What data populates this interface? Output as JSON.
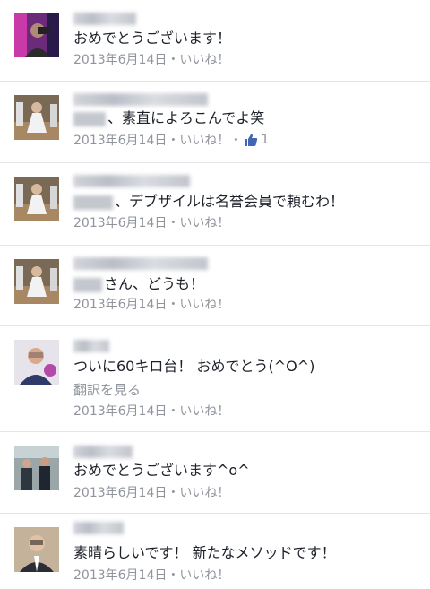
{
  "comments": [
    {
      "text": "おめでとうございます！",
      "date": "2013年6月14日",
      "dot": "・",
      "like_label": "いいね！"
    },
    {
      "text_prefix": "、素直によろこんでよ笑",
      "date": "2013年6月14日",
      "dot": "・",
      "like_label": "いいね！",
      "dot2": "・",
      "like_count": "1"
    },
    {
      "text_prefix": "、デブザイルは名誉会員で頼むわ！",
      "date": "2013年6月14日",
      "dot": "・",
      "like_label": "いいね！"
    },
    {
      "text_prefix": "さん、どうも！",
      "date": "2013年6月14日",
      "dot": "・",
      "like_label": "いいね！"
    },
    {
      "text": "ついに60キロ台！ おめでとう(^O^)",
      "translate": "翻訳を見る",
      "date": "2013年6月14日",
      "dot": "・",
      "like_label": "いいね！"
    },
    {
      "text": "おめでとうございます^o^",
      "date": "2013年6月14日",
      "dot": "・",
      "like_label": "いいね！"
    },
    {
      "text": "素晴らしいです！ 新たなメソッドです！",
      "date": "2013年6月14日",
      "dot": "・",
      "like_label": "いいね！"
    }
  ],
  "colors": {
    "text": "#1d2129",
    "meta": "#90949c",
    "divider": "#e3e5e9",
    "like_blue": "#4267b2"
  }
}
